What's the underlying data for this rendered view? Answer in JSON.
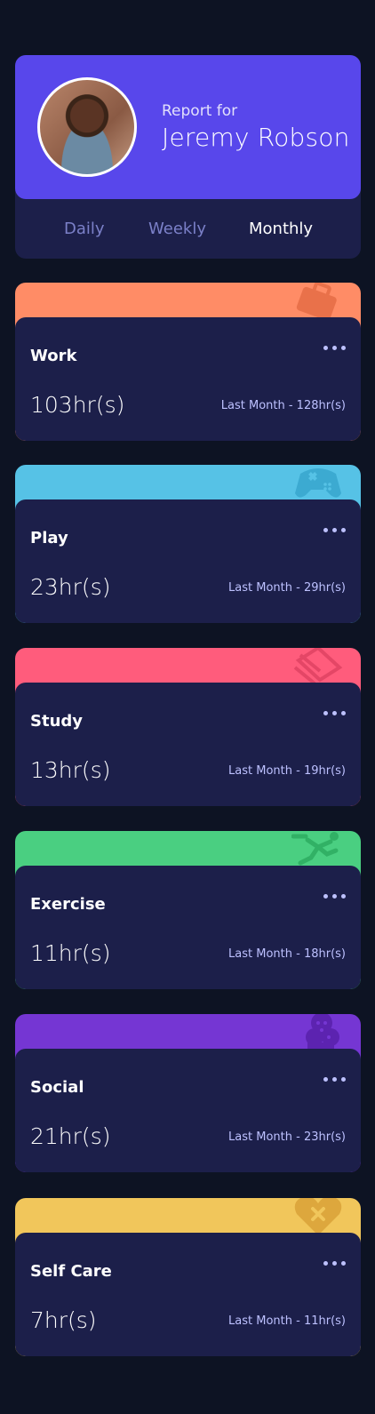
{
  "profile": {
    "report_for": "Report for",
    "name": "Jeremy Robson",
    "avatar_icon": "user-avatar"
  },
  "tabs": [
    {
      "label": "Daily",
      "active": false
    },
    {
      "label": "Weekly",
      "active": false
    },
    {
      "label": "Monthly",
      "active": true
    }
  ],
  "activities": [
    {
      "title": "Work",
      "current": "103hr(s)",
      "previous": "Last Month - 128hr(s)",
      "color": "#ff8c66",
      "icon": "briefcase-icon"
    },
    {
      "title": "Play",
      "current": "23hr(s)",
      "previous": "Last Month - 29hr(s)",
      "color": "#56c2e6",
      "icon": "gamepad-icon"
    },
    {
      "title": "Study",
      "current": "13hr(s)",
      "previous": "Last Month - 19hr(s)",
      "color": "#ff5c7c",
      "icon": "books-icon"
    },
    {
      "title": "Exercise",
      "current": "11hr(s)",
      "previous": "Last Month - 18hr(s)",
      "color": "#4acf81",
      "icon": "running-icon"
    },
    {
      "title": "Social",
      "current": "21hr(s)",
      "previous": "Last Month - 23hr(s)",
      "color": "#7536d3",
      "icon": "chat-icon"
    },
    {
      "title": "Self Care",
      "current": "7hr(s)",
      "previous": "Last Month - 11hr(s)",
      "color": "#f1c65b",
      "icon": "heart-icon"
    }
  ]
}
